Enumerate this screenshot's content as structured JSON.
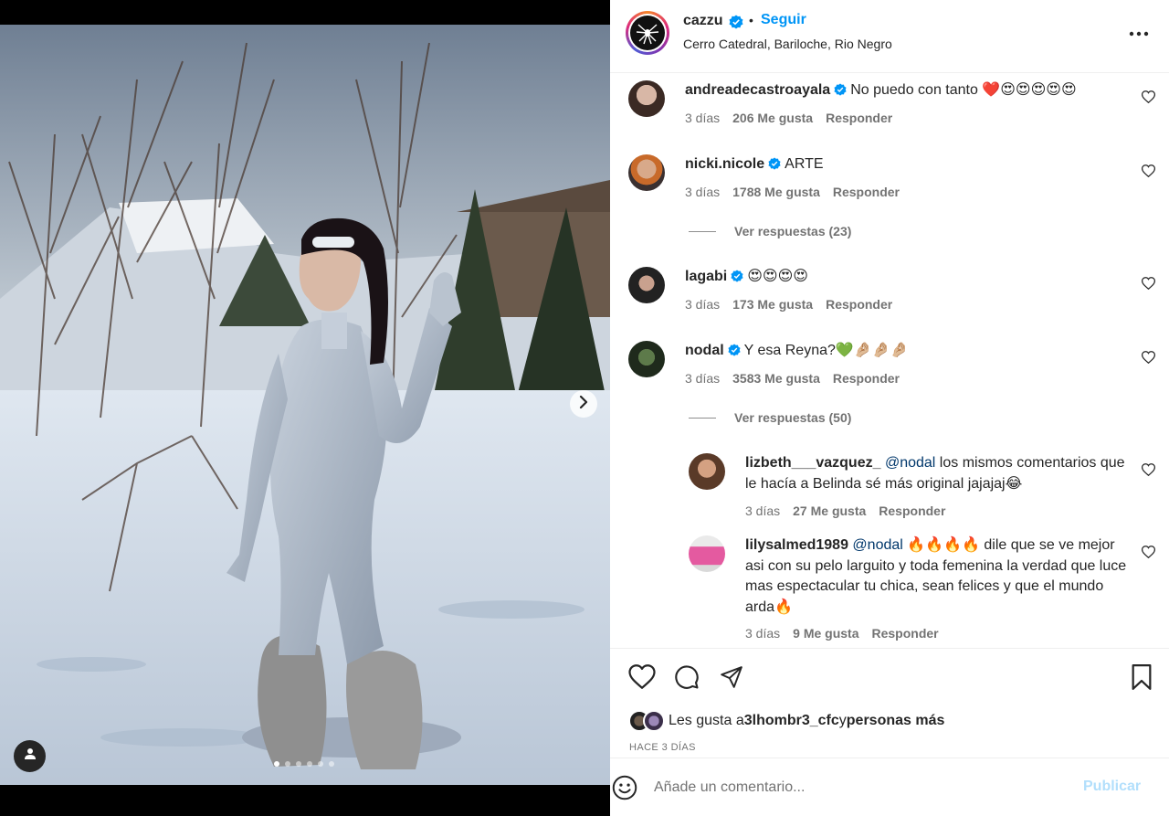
{
  "post": {
    "author": "cazzu",
    "separator": "•",
    "follow_label": "Seguir",
    "location": "Cerro Catedral, Bariloche, Rio Negro",
    "media": {
      "slide_count": 6,
      "active_slide": 1
    }
  },
  "comments": [
    {
      "user": "andreadecastroayala",
      "verified": true,
      "text": "No puedo con tanto ❤️😍😍😍😍😍",
      "time": "3 días",
      "likes": "206 Me gusta",
      "reply": "Responder"
    },
    {
      "user": "nicki.nicole",
      "verified": true,
      "text": "ARTE",
      "time": "3 días",
      "likes": "1788 Me gusta",
      "reply": "Responder",
      "view_replies": "Ver respuestas (23)"
    },
    {
      "user": "lagabi",
      "verified": true,
      "text": "😍😍😍😍",
      "time": "3 días",
      "likes": "173 Me gusta",
      "reply": "Responder"
    },
    {
      "user": "nodal",
      "verified": true,
      "text": "Y esa Reyna?💚🤌🏼🤌🏼🤌🏼",
      "time": "3 días",
      "likes": "3583 Me gusta",
      "reply": "Responder",
      "view_replies": "Ver respuestas (50)"
    }
  ],
  "replies": [
    {
      "user": "lizbeth___vazquez_",
      "mention": "@nodal",
      "text": " los mismos comentarios que le hacía a Belinda sé más original jajajaj😂",
      "time": "3 días",
      "likes": "27 Me gusta",
      "reply": "Responder"
    },
    {
      "user": "lilysalmed1989",
      "mention": "@nodal",
      "text": " 🔥🔥🔥🔥 dile que se ve mejor asi con su pelo larguito y toda femenina la verdad que luce mas espectacular tu chica, sean felices y que el mundo arda🔥",
      "time": "3 días",
      "likes": "9 Me gusta",
      "reply": "Responder"
    }
  ],
  "likes_summary": {
    "prefix": "Les gusta a ",
    "user": "3lhombr3_cfc",
    "middle": " y ",
    "rest": "personas más"
  },
  "post_time": "HACE 3 DÍAS",
  "add_comment": {
    "placeholder": "Añade un comentario...",
    "publish_label": "Publicar"
  },
  "colors": {
    "link": "#0095f6",
    "verified": "#0095f6",
    "publish_disabled": "#b2dffc",
    "muted": "#737373"
  },
  "icons": [
    "chevron-right-icon",
    "user-tag-icon",
    "more-icon",
    "heart-icon",
    "comment-icon",
    "share-icon",
    "bookmark-icon",
    "emoji-icon",
    "verified-icon"
  ]
}
